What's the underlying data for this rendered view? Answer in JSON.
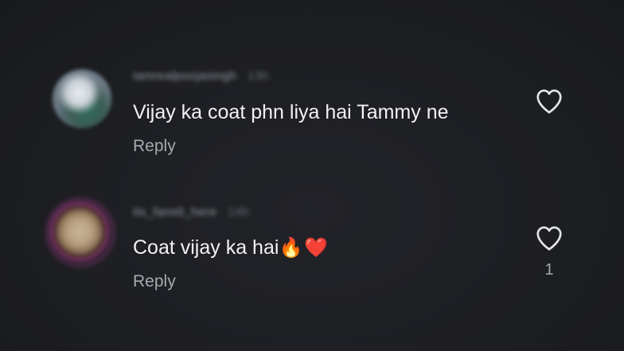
{
  "comments": [
    {
      "username": "iamrealpoojasingh",
      "time": "13h",
      "text": "Vijay ka coat phn liya hai Tammy ne",
      "reply_label": "Reply",
      "like_icon": "heart-outline-icon",
      "like_count": ""
    },
    {
      "username": "its_fans0_here",
      "time": "14h",
      "text": "Coat vijay ka hai",
      "emojis": [
        "🔥",
        "❤️"
      ],
      "reply_label": "Reply",
      "like_icon": "heart-outline-icon",
      "like_count": "1"
    }
  ],
  "colors": {
    "background": "#1d1e22",
    "text": "#f2f2f2",
    "secondary_text": "#a5a9ae",
    "heart_emoji": "#e5222f",
    "fire_emoji": "#ff7a1a"
  }
}
